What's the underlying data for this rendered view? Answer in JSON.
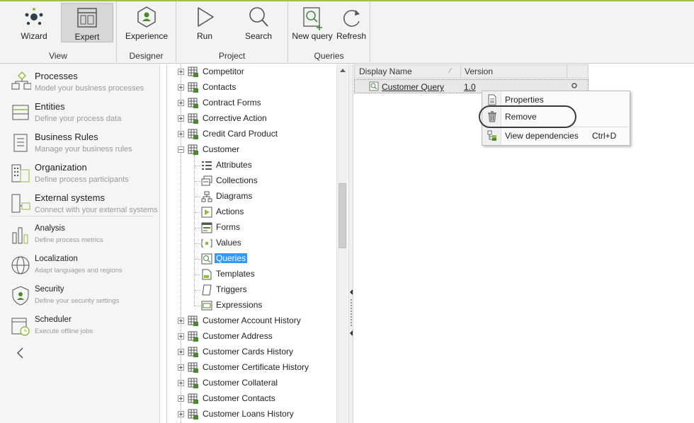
{
  "ribbon": {
    "groups": [
      {
        "label": "View",
        "buttons": [
          {
            "label": "Wizard",
            "icon": "wizard-icon"
          },
          {
            "label": "Expert",
            "icon": "expert-icon",
            "active": true
          }
        ]
      },
      {
        "label": "Designer",
        "buttons": [
          {
            "label": "Experience",
            "icon": "experience-icon"
          }
        ]
      },
      {
        "label": "Project",
        "buttons": [
          {
            "label": "Run",
            "icon": "run-icon"
          },
          {
            "label": "Search",
            "icon": "search-icon"
          }
        ]
      },
      {
        "label": "Queries",
        "buttons": [
          {
            "label": "New query",
            "icon": "new-query-icon"
          },
          {
            "label": "Refresh",
            "icon": "refresh-icon"
          }
        ]
      }
    ]
  },
  "leftnav": {
    "items": [
      {
        "title": "Processes",
        "subtitle": "Model your business processes",
        "icon": "processes-icon"
      },
      {
        "title": "Entities",
        "subtitle": "Define your process data",
        "icon": "entities-icon"
      },
      {
        "title": "Business Rules",
        "subtitle": "Manage your business rules",
        "icon": "business-rules-icon"
      },
      {
        "title": "Organization",
        "subtitle": "Define process participants",
        "icon": "organization-icon"
      },
      {
        "title": "External systems",
        "subtitle": "Connect with your external systems",
        "icon": "external-systems-icon"
      },
      {
        "title": "Analysis",
        "subtitle": "Define process metrics",
        "icon": "analysis-icon"
      },
      {
        "title": "Localization",
        "subtitle": "Adapt languages and regions",
        "icon": "globe-icon"
      },
      {
        "title": "Security",
        "subtitle": "Define your security settings",
        "icon": "shield-icon"
      },
      {
        "title": "Scheduler",
        "subtitle": "Execute offline jobs",
        "icon": "scheduler-icon"
      }
    ]
  },
  "tree": {
    "nodes": [
      {
        "label": "Competitor",
        "level": 0,
        "expander": "plus"
      },
      {
        "label": "Contacts",
        "level": 0,
        "expander": "plus"
      },
      {
        "label": "Contract Forms",
        "level": 0,
        "expander": "plus"
      },
      {
        "label": "Corrective Action",
        "level": 0,
        "expander": "plus"
      },
      {
        "label": "Credit Card Product",
        "level": 0,
        "expander": "plus"
      },
      {
        "label": "Customer",
        "level": 0,
        "expander": "minus"
      },
      {
        "label": "Attributes",
        "level": 1
      },
      {
        "label": "Collections",
        "level": 1
      },
      {
        "label": "Diagrams",
        "level": 1
      },
      {
        "label": "Actions",
        "level": 1
      },
      {
        "label": "Forms",
        "level": 1
      },
      {
        "label": "Values",
        "level": 1
      },
      {
        "label": "Queries",
        "level": 1,
        "selected": true
      },
      {
        "label": "Templates",
        "level": 1
      },
      {
        "label": "Triggers",
        "level": 1
      },
      {
        "label": "Expressions",
        "level": 1
      },
      {
        "label": "Customer Account History",
        "level": 0,
        "expander": "plus"
      },
      {
        "label": "Customer Address",
        "level": 0,
        "expander": "plus"
      },
      {
        "label": "Customer Cards History",
        "level": 0,
        "expander": "plus"
      },
      {
        "label": "Customer Certificate History",
        "level": 0,
        "expander": "plus"
      },
      {
        "label": "Customer Collateral",
        "level": 0,
        "expander": "plus"
      },
      {
        "label": "Customer Contacts",
        "level": 0,
        "expander": "plus"
      },
      {
        "label": "Customer Loans History",
        "level": 0,
        "expander": "plus"
      }
    ]
  },
  "grid": {
    "columns": [
      "Display Name",
      "Version"
    ],
    "rows": [
      {
        "name": "Customer Query",
        "version": "1.0"
      }
    ]
  },
  "context_menu": {
    "items": [
      {
        "label": "Properties",
        "shortcut": "",
        "icon": "properties-icon"
      },
      {
        "label": "Remove",
        "shortcut": "",
        "icon": "trash-icon"
      },
      {
        "label": "View dependencies",
        "shortcut": "Ctrl+D",
        "icon": "dependencies-icon"
      }
    ]
  },
  "colors": {
    "accent": "#9cc24a",
    "selection": "#3399ff",
    "entity_icon": "#4a8a2a"
  }
}
